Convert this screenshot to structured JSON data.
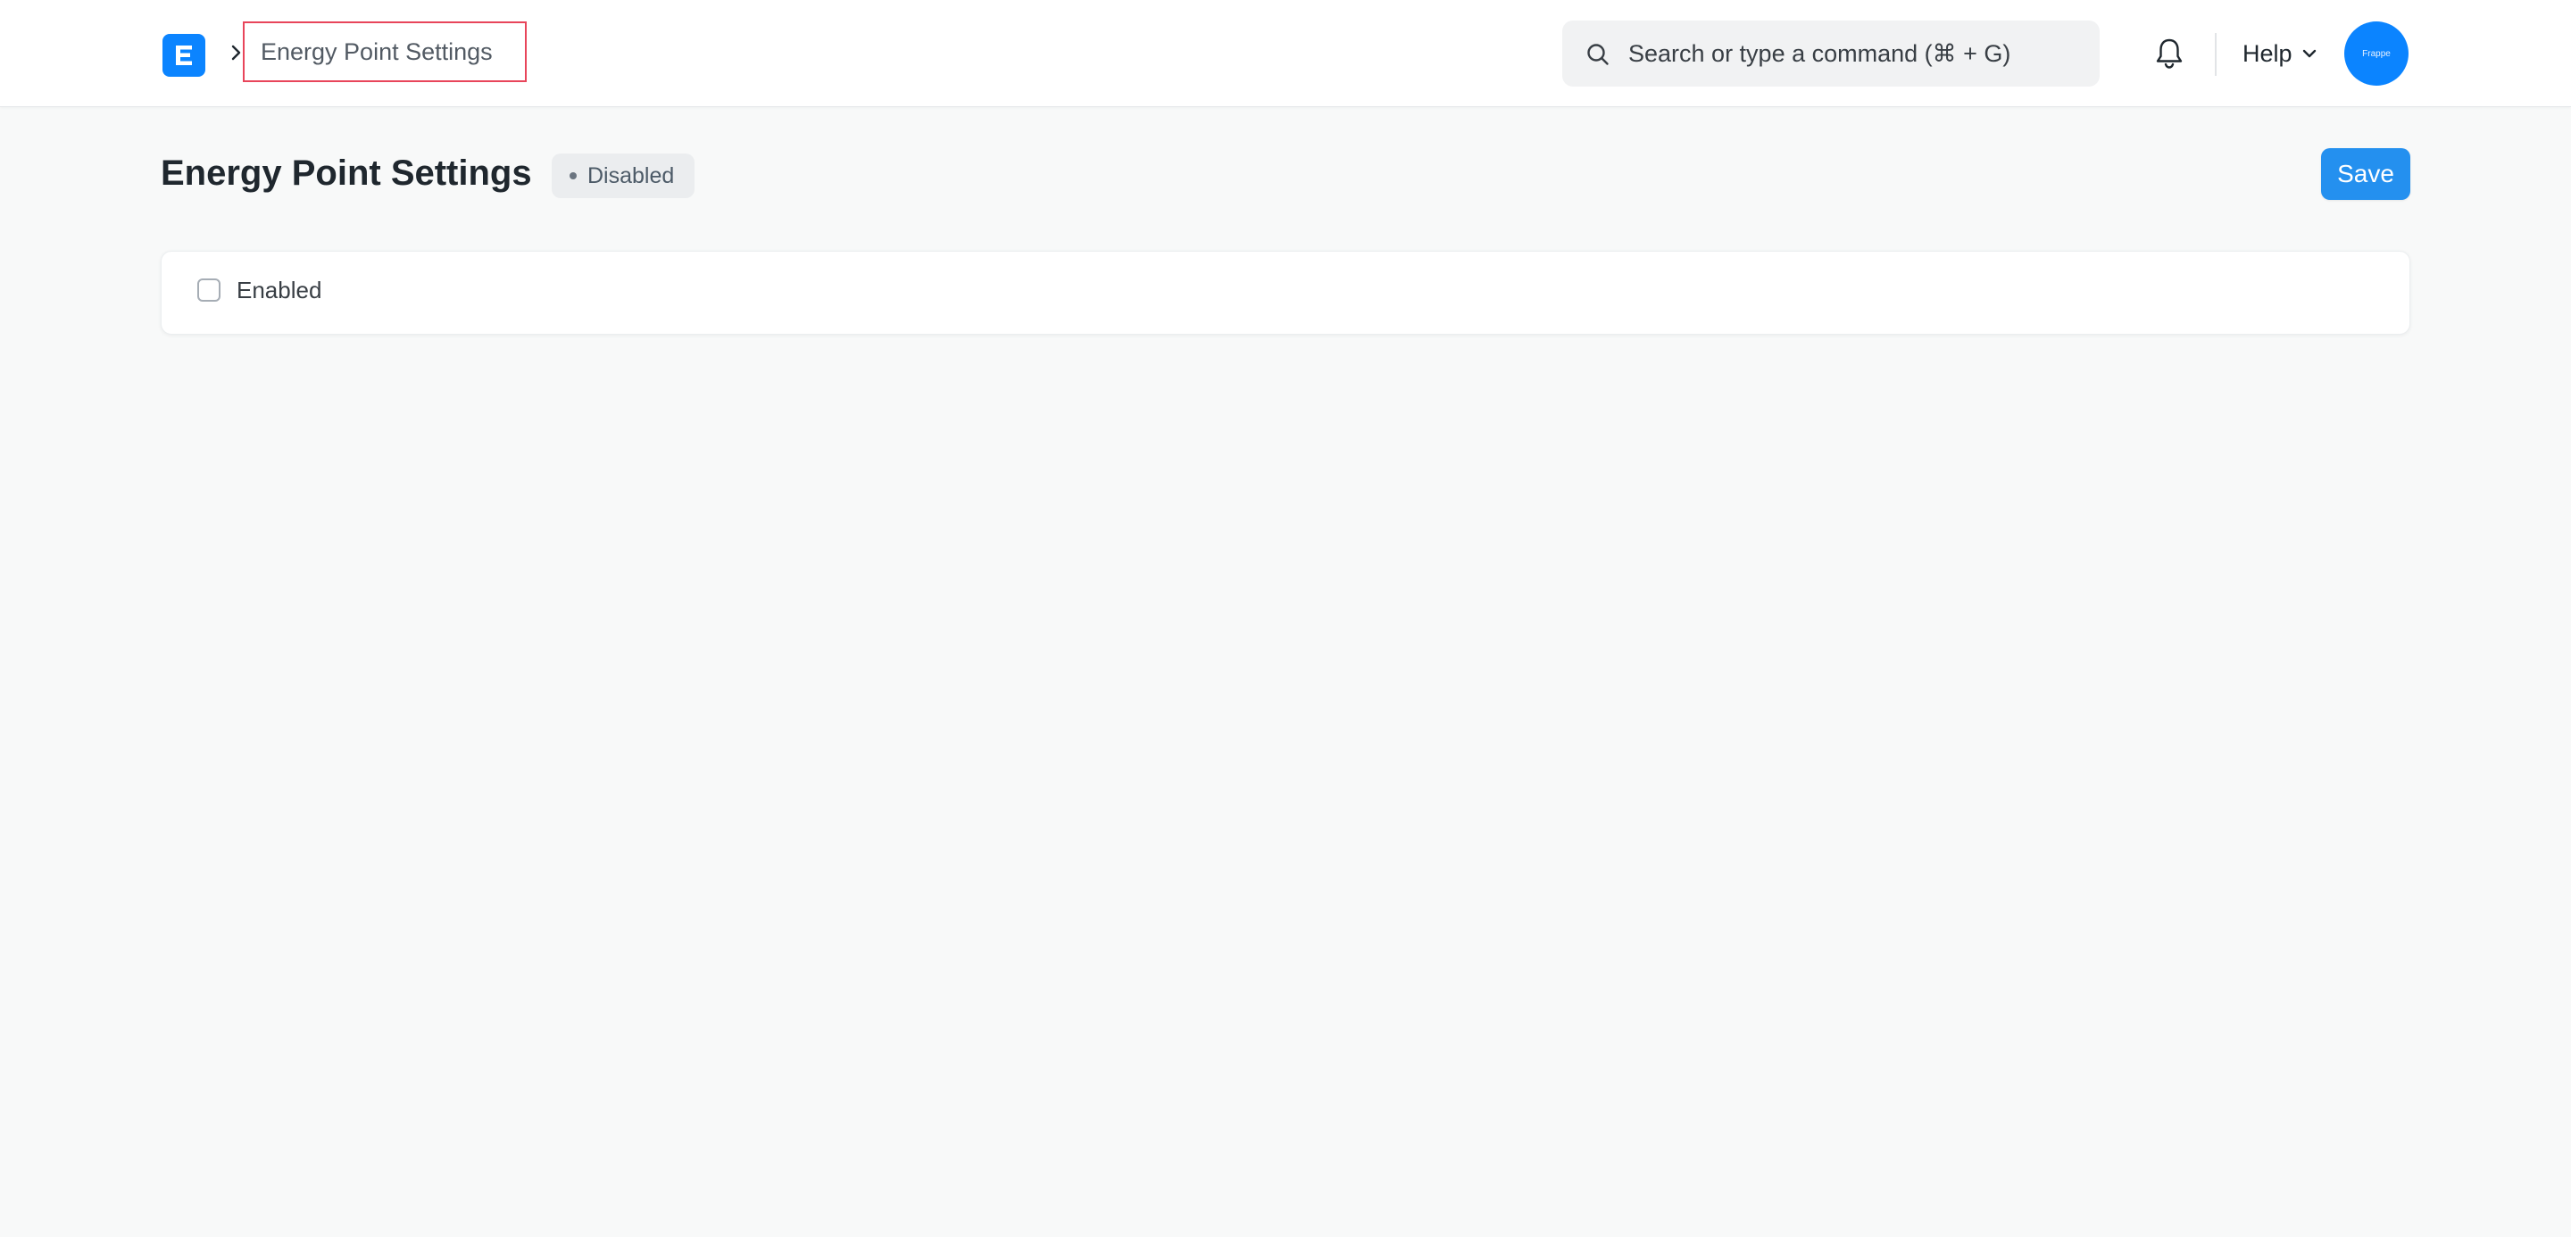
{
  "navbar": {
    "logo_letter": "E",
    "breadcrumb": "Energy Point Settings",
    "search_placeholder": "Search or type a command (⌘ + G)",
    "help_label": "Help",
    "avatar_text": "Frappe"
  },
  "page": {
    "title": "Energy Point Settings",
    "status": "Disabled",
    "save_label": "Save"
  },
  "form": {
    "enabled_label": "Enabled",
    "enabled_checked": false
  },
  "colors": {
    "accent": "#2490ef",
    "logo": "#0b84ff",
    "breadcrumb_highlight": "#e8455a"
  },
  "icons": {
    "search": "search-icon",
    "bell": "bell-icon",
    "chevron": "chevron-down-icon",
    "breadcrumb_separator": "chevron-right-icon"
  }
}
